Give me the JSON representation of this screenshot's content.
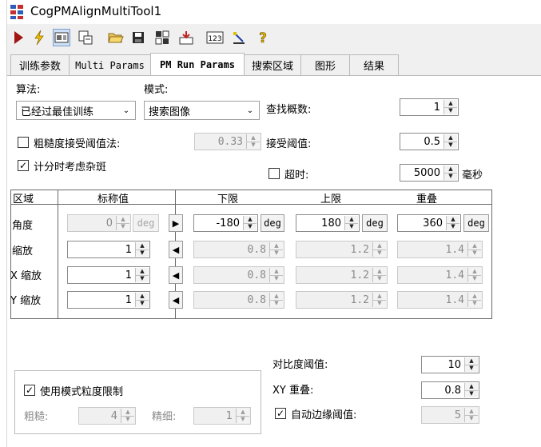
{
  "window": {
    "title": "CogPMAlignMultiTool1"
  },
  "toolbar": {
    "buttons": [
      "run-icon",
      "electric-icon",
      "image-view-icon",
      "layout-icon",
      "open-folder-icon",
      "save-icon",
      "grid-icon",
      "import-icon",
      "numeric-icon",
      "ruler-icon",
      "help-icon"
    ]
  },
  "tabs": [
    "训练参数",
    "Multi Params",
    "PM Run Params",
    "搜索区域",
    "图形",
    "结果"
  ],
  "algorithm": {
    "label": "算法:",
    "value": "已经过最佳训练"
  },
  "mode": {
    "label": "模式:",
    "value": "搜索图像"
  },
  "find_count": {
    "label": "查找概数:",
    "value": "1"
  },
  "coarse": {
    "label": "粗糙度接受阈值法:",
    "value": "0.33",
    "checked": false
  },
  "accept": {
    "label": "接受阈值:",
    "value": "0.5"
  },
  "clutter": {
    "label": "计分时考虑杂斑",
    "checked": true
  },
  "timeout": {
    "label": "超时:",
    "value": "5000",
    "unit": "毫秒",
    "checked": false
  },
  "table": {
    "headers": {
      "region": "区域",
      "nominal": "标称值",
      "low": "下限",
      "high": "上限",
      "overlap": "重叠"
    },
    "rows": [
      {
        "label": "角度",
        "nominal": "0",
        "nominal_unit": "deg",
        "arrow": "▶",
        "low": "-180",
        "low_unit": "deg",
        "high": "180",
        "high_unit": "deg",
        "overlap": "360",
        "overlap_unit": "deg"
      },
      {
        "label": "缩放",
        "nominal": "1",
        "arrow": "◀",
        "low": "0.8",
        "high": "1.2",
        "overlap": "1.4"
      },
      {
        "label": "X 缩放",
        "nominal": "1",
        "arrow": "◀",
        "low": "0.8",
        "high": "1.2",
        "overlap": "1.4"
      },
      {
        "label": "Y 缩放",
        "nominal": "1",
        "arrow": "◀",
        "low": "0.8",
        "high": "1.2",
        "overlap": "1.4"
      }
    ]
  },
  "contrast": {
    "label": "对比度阈值:",
    "value": "10"
  },
  "xy_overlap": {
    "label": "XY 重叠:",
    "value": "0.8"
  },
  "auto_edge": {
    "label": "自动边缘阈值:",
    "value": "5",
    "checked": true
  },
  "granularity": {
    "label": "使用模式粒度限制",
    "checked": true,
    "coarse_label": "粗糙:",
    "coarse_value": "4",
    "fine_label": "精细:",
    "fine_value": "1"
  }
}
